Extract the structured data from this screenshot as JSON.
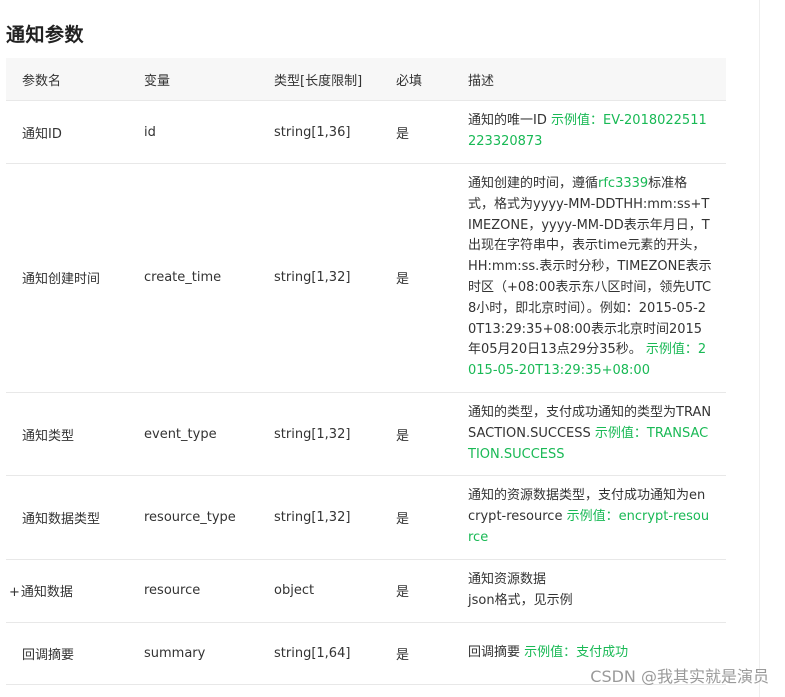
{
  "section": {
    "title": "通知参数"
  },
  "table": {
    "headers": [
      "参数名",
      "变量",
      "类型[长度限制]",
      "必填",
      "描述"
    ],
    "rows": [
      {
        "name": "通知ID",
        "variable": "id",
        "type": "string[1,36]",
        "required": "是",
        "desc_lines": [
          "通知的唯一ID"
        ],
        "example": "示例值：EV-2018022511223320873"
      },
      {
        "name": "通知创建时间",
        "variable": "create_time",
        "type": "string[1,32]",
        "required": "是",
        "desc_prefix": "通知创建的时间，遵循",
        "desc_link": "rfc3339",
        "desc_suffix": "标准格式，格式为yyyy-MM-DDTHH:mm:ss+TIMEZONE，yyyy-MM-DD表示年月日，T出现在字符串中，表示time元素的开头，HH:mm:ss.表示时分秒，TIMEZONE表示时区（+08:00表示东八区时间，领先UTC 8小时，即北京时间）。例如：2015-05-20T13:29:35+08:00表示北京时间2015年05月20日13点29分35秒。",
        "example": "示例值：2015-05-20T13:29:35+08:00"
      },
      {
        "name": "通知类型",
        "variable": "event_type",
        "type": "string[1,32]",
        "required": "是",
        "desc_lines": [
          "通知的类型，支付成功通知的类型为TRANSACTION.SUCCESS"
        ],
        "example": "示例值：TRANSACTION.SUCCESS"
      },
      {
        "name": "通知数据类型",
        "variable": "resource_type",
        "type": "string[1,32]",
        "required": "是",
        "desc_lines": [
          "通知的资源数据类型，支付成功通知为encrypt-resource"
        ],
        "example": "示例值：encrypt-resource"
      },
      {
        "expander": "+",
        "name": "通知数据",
        "variable": "resource",
        "type": "object",
        "required": "是",
        "desc_lines": [
          "通知资源数据",
          "json格式，见示例"
        ]
      },
      {
        "name": "回调摘要",
        "variable": "summary",
        "type": "string[1,64]",
        "required": "是",
        "desc_lines": [
          "回调摘要"
        ],
        "example": "示例值：支付成功"
      }
    ]
  },
  "watermark": "CSDN @我其实就是演员",
  "colors": {
    "example_green": "#19b955",
    "header_bg": "#f7f7f7",
    "row_border": "#e8e8e8"
  }
}
